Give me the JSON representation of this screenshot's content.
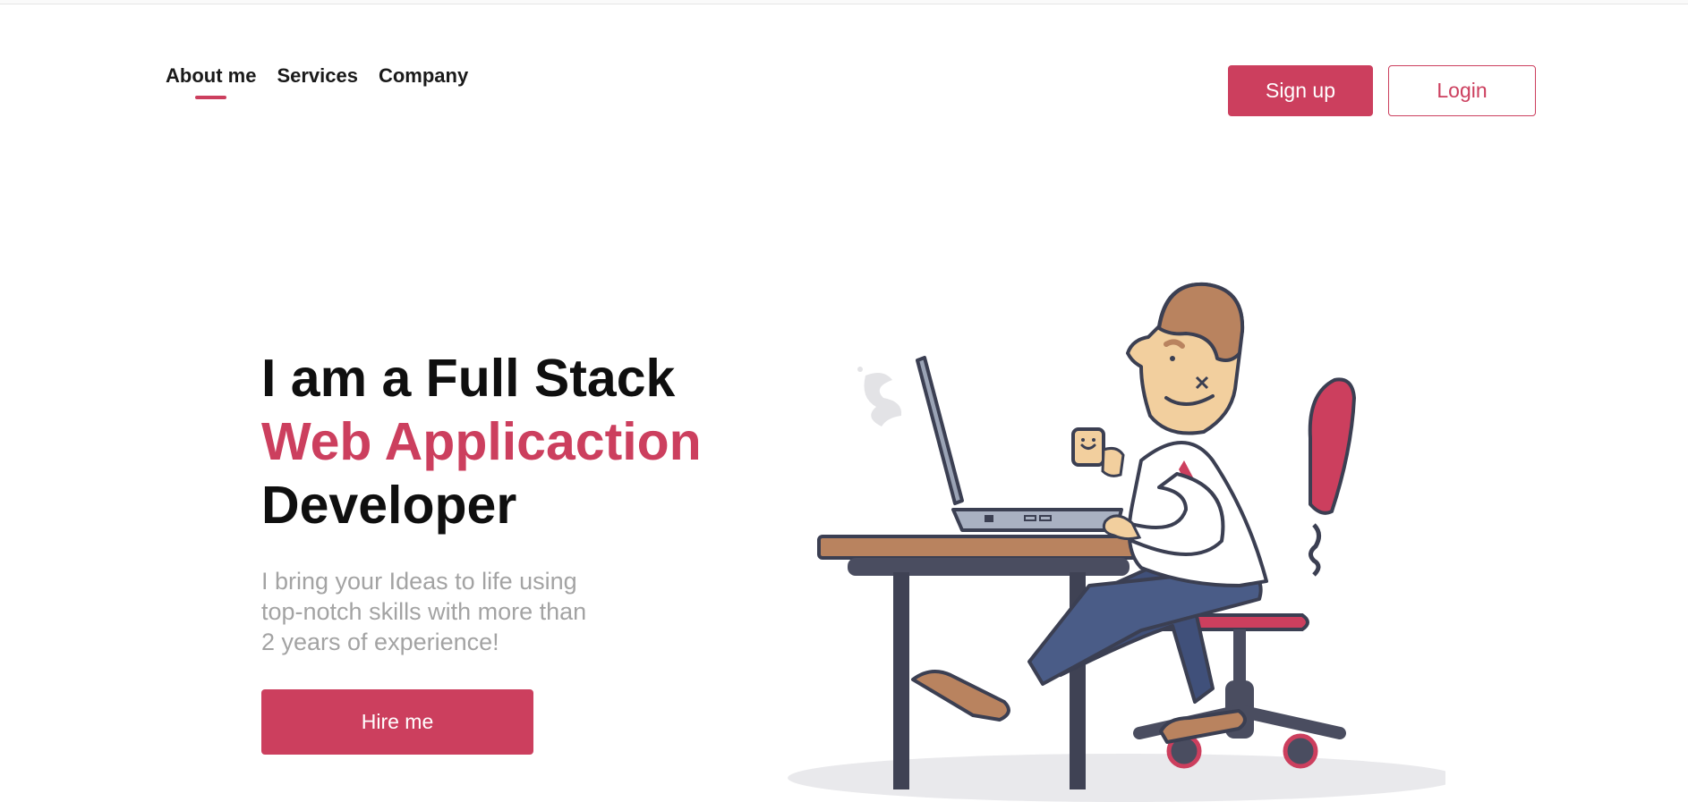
{
  "nav": {
    "items": [
      {
        "label": "About me",
        "active": true
      },
      {
        "label": "Services",
        "active": false
      },
      {
        "label": "Company",
        "active": false
      }
    ]
  },
  "auth": {
    "signup_label": "Sign up",
    "login_label": "Login"
  },
  "hero": {
    "line1": "I am a Full Stack",
    "line2": "Web Applicaction",
    "line3": "Developer",
    "description_lines": [
      "I bring your Ideas to life using",
      "top-notch skills with more than",
      "2 years of experience!"
    ],
    "cta_label": "Hire me"
  },
  "colors": {
    "accent": "#cc3f5e",
    "text": "#0f0f0f",
    "muted": "#a3a3a3"
  }
}
